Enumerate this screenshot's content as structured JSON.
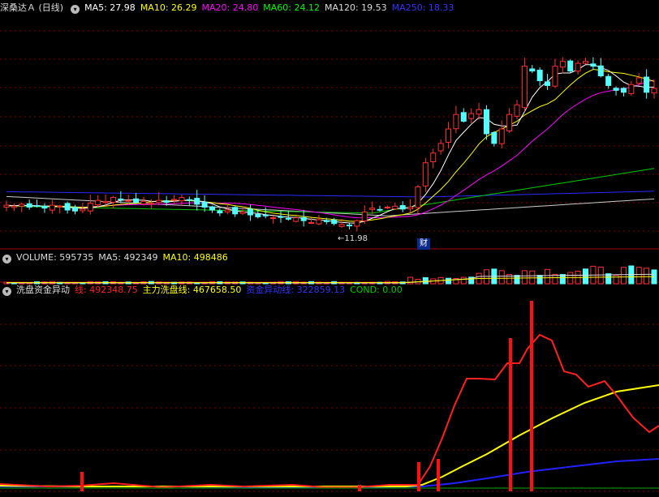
{
  "main": {
    "title": "深桑达Ａ (日线)",
    "ma": [
      {
        "label": "MA5: 27.98",
        "color": "#ffffff"
      },
      {
        "label": "MA10: 26.29",
        "color": "#ffff00"
      },
      {
        "label": "MA20: 24.80",
        "color": "#ff00ff"
      },
      {
        "label": "MA60: 24.12",
        "color": "#00ff00"
      },
      {
        "label": "MA120: 19.53",
        "color": "#dddddd"
      },
      {
        "label": "MA250: 18.33",
        "color": "#3333ff"
      }
    ],
    "low_label": "←11.98",
    "fin_marker": "财"
  },
  "volume": {
    "items": [
      {
        "label": "VOLUME: 595735",
        "color": "#dddddd"
      },
      {
        "label": "MA5: 492349",
        "color": "#dddddd"
      },
      {
        "label": "MA10: 498486",
        "color": "#ffff00"
      }
    ]
  },
  "indicator": {
    "name": "洗盘资金异动",
    "items": [
      {
        "label": "线: 492348.75",
        "color": "#ff2020"
      },
      {
        "label": "主力洗盘线: 467658.50",
        "color": "#ffff00"
      },
      {
        "label": "资金异动线: 322859.13",
        "color": "#3333ff"
      },
      {
        "label": "COND: 0.00",
        "color": "#00cc00"
      }
    ]
  },
  "colors": {
    "up": "#ff3030",
    "down": "#54ffff",
    "grid": "#7a0000"
  },
  "chart_data": [
    {
      "type": "candlestick",
      "ohlc_comment_free": true,
      "close": [
        14.1,
        14.0,
        14.2,
        13.9,
        14.0,
        13.8,
        14.1,
        14.0,
        13.6,
        13.5,
        13.7,
        14.3,
        14.6,
        14.5,
        14.9,
        14.7,
        14.6,
        14.4,
        14.5,
        14.3,
        14.6,
        14.4,
        14.7,
        14.9,
        14.6,
        14.2,
        13.9,
        13.6,
        13.3,
        13.6,
        13.2,
        13.4,
        13.1,
        12.9,
        13.0,
        12.8,
        12.9,
        12.7,
        12.8,
        12.5,
        12.3,
        12.6,
        12.4,
        12.2,
        12.1,
        11.98,
        12.5,
        13.4,
        13.8,
        13.6,
        13.9,
        14.0,
        13.7,
        13.9,
        16.0,
        18.5,
        19.5,
        20.5,
        22.0,
        23.5,
        22.8,
        23.6,
        24.0,
        21.5,
        20.5,
        22.0,
        23.5,
        24.5,
        28.5,
        28.0,
        27.0,
        26.5,
        28.5,
        29.0,
        28.0,
        28.8,
        29.0,
        28.5,
        27.5,
        26.5,
        26.0,
        25.8,
        26.6,
        27.3,
        25.8,
        26.2
      ],
      "low_annotation": 11.98,
      "ylim": [
        11,
        32
      ]
    },
    {
      "type": "bar",
      "name": "VOLUME",
      "last_value": 595735
    },
    {
      "type": "line",
      "series": [
        {
          "name": "线",
          "last_value": 492348.75
        },
        {
          "name": "主力洗盘线",
          "last_value": 467658.5
        },
        {
          "name": "资金异动线",
          "last_value": 322859.13
        },
        {
          "name": "COND",
          "last_value": 0.0
        }
      ]
    }
  ]
}
